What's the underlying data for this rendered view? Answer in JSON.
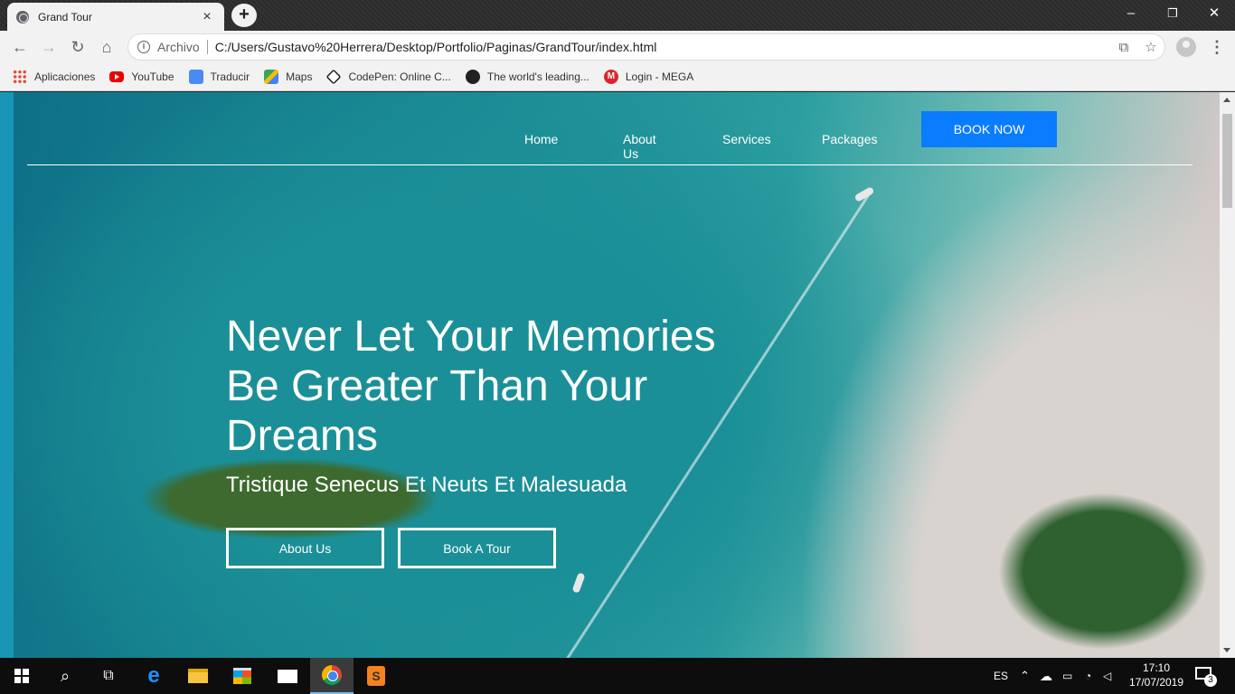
{
  "browser": {
    "tab_title": "Grand Tour",
    "tab_close": "×",
    "new_tab": "+",
    "window": {
      "minimize": "–",
      "maximize": "❐",
      "close": "✕"
    },
    "address": {
      "scheme_label": "Archivo",
      "url": "C:/Users/Gustavo%20Herrera/Desktop/Portfolio/Paginas/GrandTour/index.html"
    },
    "bookmarks": [
      {
        "icon": "apps-icon",
        "label": "Aplicaciones"
      },
      {
        "icon": "youtube-icon",
        "label": "YouTube"
      },
      {
        "icon": "translate-icon",
        "label": "Traducir"
      },
      {
        "icon": "maps-icon",
        "label": "Maps"
      },
      {
        "icon": "codepen-icon",
        "label": "CodePen: Online C..."
      },
      {
        "icon": "github-icon",
        "label": "The world's leading..."
      },
      {
        "icon": "mega-icon",
        "label": "Login - MEGA"
      }
    ]
  },
  "site": {
    "nav": {
      "home": "Home",
      "about": "About Us",
      "services": "Services",
      "packages": "Packages",
      "book_now": "BOOK NOW"
    },
    "hero": {
      "headline": "Never Let Your Memories Be Greater Than Your Dreams",
      "subline": "Tristique Senecus Et Neuts Et Malesuada",
      "btn_about": "About Us",
      "btn_tour": "Book A Tour"
    }
  },
  "taskbar": {
    "language": "ES",
    "time": "17:10",
    "date": "17/07/2019",
    "notifications": "3"
  }
}
